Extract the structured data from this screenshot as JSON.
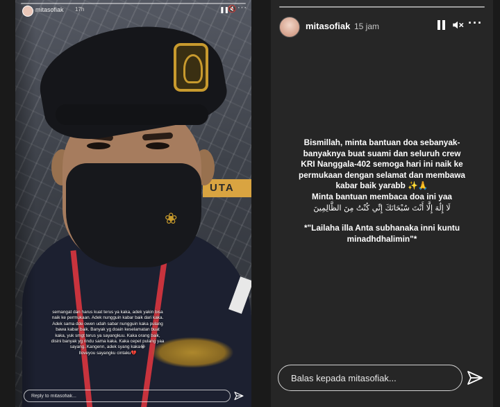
{
  "left_story": {
    "username": "mitasofiak",
    "time": "17h",
    "caption": "semangat dan harus kuat terus ya kaka, adek yakin bisa\nnaik ke permukaan. Adek nungguin kabar baik dari kaka.\nAdek sama dde owen udah sabar nungguin kaka pulang\nbawa kabar baik. Banyak yg doain keselamatan buat\nkaka, yuk smgt terus ya sayangkuu. Kaka orang baik,\ndisini banyak yg rindu sama kaka. Kaka cepet pulang yaa\nsayang. Kangenn, adek syang kaka😭\nIloveyou sayangku cintaku💔",
    "reply_placeholder": "Reply to mitasofiak..."
  },
  "right_story": {
    "username": "mitasofiak",
    "time": "15 jam",
    "text_main": "Bismillah, minta bantuan doa sebanyak-\nbanyaknya buat suami dan seluruh crew\nKRI Nanggala-402 semoga hari ini naik ke\npermukaan dengan selamat dan membawa\nkabar baik yarabb ✨🙏\nMinta bantuan membaca doa ini yaa",
    "text_arabic": "لَا إِلَٰهَ إِلَّا أَنْتَ سُبْحَانَكَ إِنِّي كُنْتُ مِنَ الظَّالِمِينَ",
    "text_translit": "*\"Lailaha illa Anta subhanaka inni kuntu\nminadhdhalimin\"*",
    "reply_placeholder": "Balas kepada mitasofiak..."
  },
  "sign_text": "UTA",
  "icons": [
    "pause-icon",
    "mute-icon",
    "more-icon",
    "send-icon"
  ],
  "colors": {
    "background": "#1a1a1a",
    "story_bg": "#262626",
    "text": "#ffffff"
  }
}
